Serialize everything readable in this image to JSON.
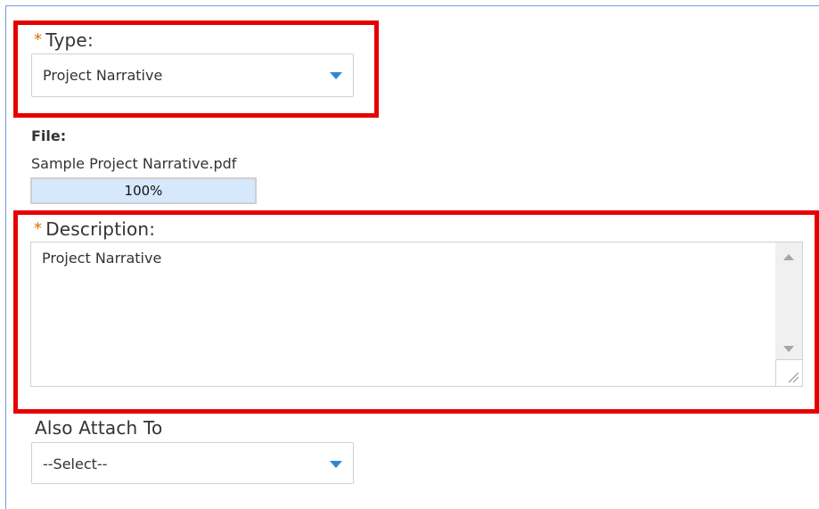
{
  "type_field": {
    "required_mark": "*",
    "label": "Type:",
    "value": "Project Narrative",
    "caret_icon": "caret-down-icon"
  },
  "file": {
    "label": "File:",
    "name": "Sample Project Narrative.pdf",
    "progress_text": "100%",
    "progress_fraction": 1.0
  },
  "description": {
    "required_mark": "*",
    "label": "Description:",
    "value": "Project Narrative"
  },
  "also_attach": {
    "label": "Also Attach To",
    "value": "--Select--",
    "caret_icon": "caret-down-icon"
  },
  "colors": {
    "highlight": "#e60000",
    "required": "#e07000",
    "caret": "#2a88d8",
    "progress_fill": "#d6e8fb"
  }
}
